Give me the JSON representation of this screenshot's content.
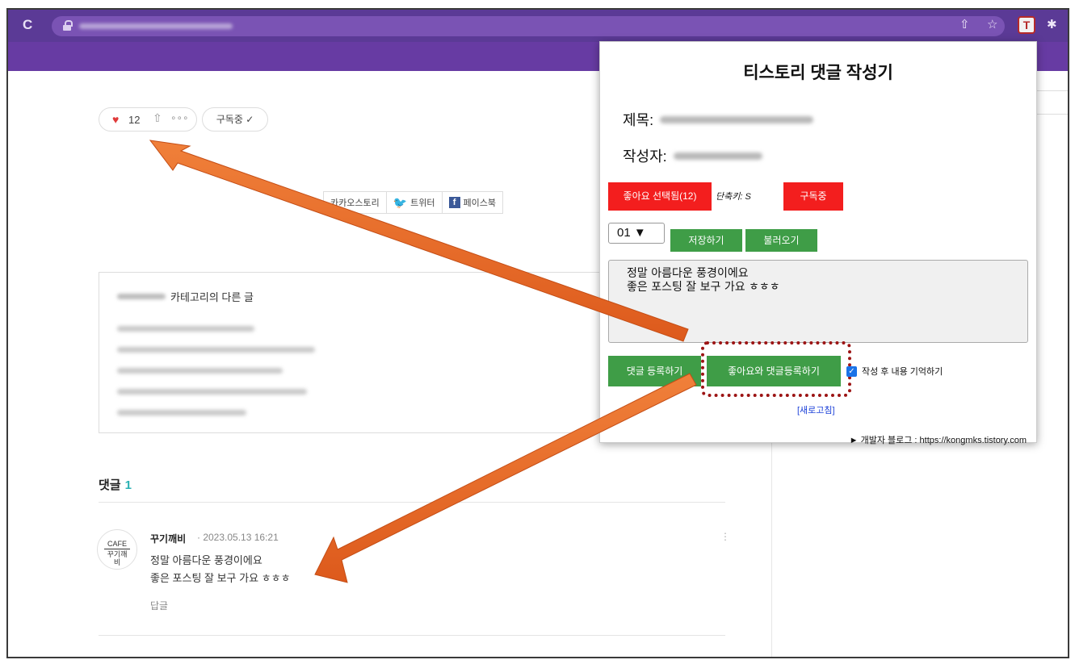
{
  "browser": {
    "reload_glyph": "C",
    "reload_icon": "reload-icon",
    "share_glyph": "⇧",
    "star_glyph": "☆",
    "extension_letter": "T",
    "puzzle_glyph": "✱"
  },
  "blog": {
    "like_count": "12",
    "more_glyph": "∘∘∘",
    "subscribe_label": "구독중 ✓",
    "share_buttons": {
      "kakao": "카카오스토리",
      "twitter": "트위터",
      "facebook": "페이스북"
    },
    "related_suffix": "카테고리의 다른 글",
    "comments_label": "댓글",
    "comments_count": "1",
    "comment": {
      "avatar_line1": "CAFE",
      "avatar_line2": "꾸기깨비",
      "author": "꾸기깨비",
      "timestamp": "· 2023.05.13 16:21",
      "menu_glyph": "⋮",
      "line1": "정말 아름다운 풍경이에요",
      "line2": "좋은 포스팅 잘 보구 가요 ㅎㅎㅎ",
      "reply_label": "답글"
    }
  },
  "popup": {
    "title": "티스토리 댓글 작성기",
    "title_label": "제목:",
    "author_label": "작성자:",
    "like_button": "좋아요 선택됨(12)",
    "shortcut_hint": "단축키: S",
    "subscribe_button": "구독중",
    "slot_value": "01 ▼",
    "save_button": "저장하기",
    "load_button": "불러오기",
    "textarea_value": "정말 아름다운 풍경이에요\n좋은 포스팅 잘 보구 가요 ㅎㅎㅎ",
    "submit_button": "댓글 등록하기",
    "like_submit_button": "좋아요와 댓글등록하기",
    "remember_checked": true,
    "remember_label": "작성 후 내용 기억하기",
    "refresh_link": "[새로고침]",
    "dev_blog": "► 개발자 블로그 : https://kongmks.tistory.com"
  },
  "colors": {
    "toolbar": "#5b3a96",
    "brand_purple": "#673ba3",
    "red_button": "#f31e1e",
    "green_button": "#3f9d47",
    "arrow": "#e8692a",
    "highlight": "#9c1414",
    "comment_count": "#2ab1b3"
  }
}
